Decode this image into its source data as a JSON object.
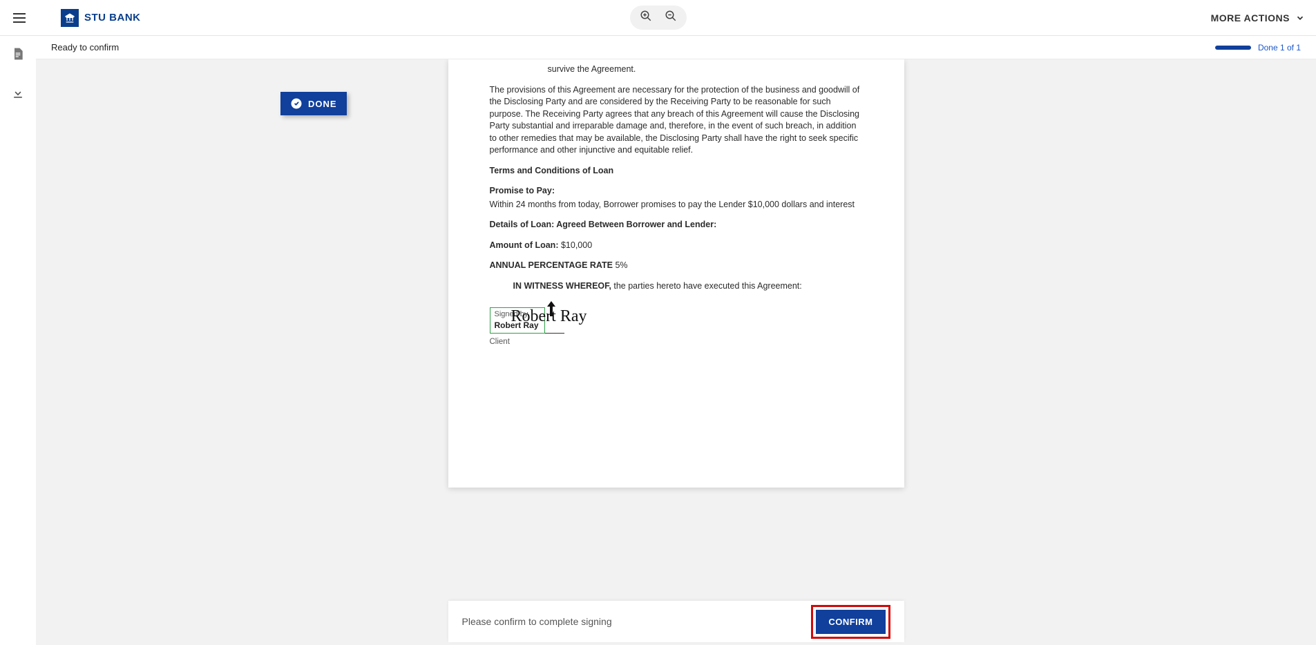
{
  "header": {
    "brand": "STU BANK",
    "more_actions": "MORE ACTIONS"
  },
  "status": {
    "ready": "Ready to confirm",
    "done_text": "Done 1 of 1"
  },
  "done_badge": "DONE",
  "document": {
    "survive": "survive the Agreement.",
    "provisions": "The provisions of this Agreement are necessary for the protection of the business and goodwill of the Disclosing Party and are considered by the Receiving Party to be reasonable for such purpose. The Receiving Party agrees that any breach of this Agreement will cause the Disclosing Party substantial and irreparable damage and, therefore, in the event of such breach, in addition to other remedies that may be available, the Disclosing Party shall have the right to seek specific performance and other injunctive and equitable relief.",
    "tc_heading": "Terms and Conditions of Loan",
    "promise_label": "Promise to Pay:",
    "promise_text": "Within 24 months from today, Borrower promises to pay the Lender $10,000 dollars and interest",
    "details": "Details of Loan: Agreed Between Borrower and Lender:",
    "amount_label": "Amount of Loan:",
    "amount_value": " $10,000",
    "apr_label": "ANNUAL PERCENTAGE RATE",
    "apr_value": " 5%",
    "witness_label": "IN WITNESS WHEREOF,",
    "witness_text": " the parties hereto have executed this Agreement:",
    "signed_by": "Signed by",
    "signer": "Robert Ray",
    "signature_script": "Robert Ray",
    "client_label": "Client"
  },
  "confirm": {
    "message": "Please confirm to complete signing",
    "button": "CONFIRM"
  }
}
